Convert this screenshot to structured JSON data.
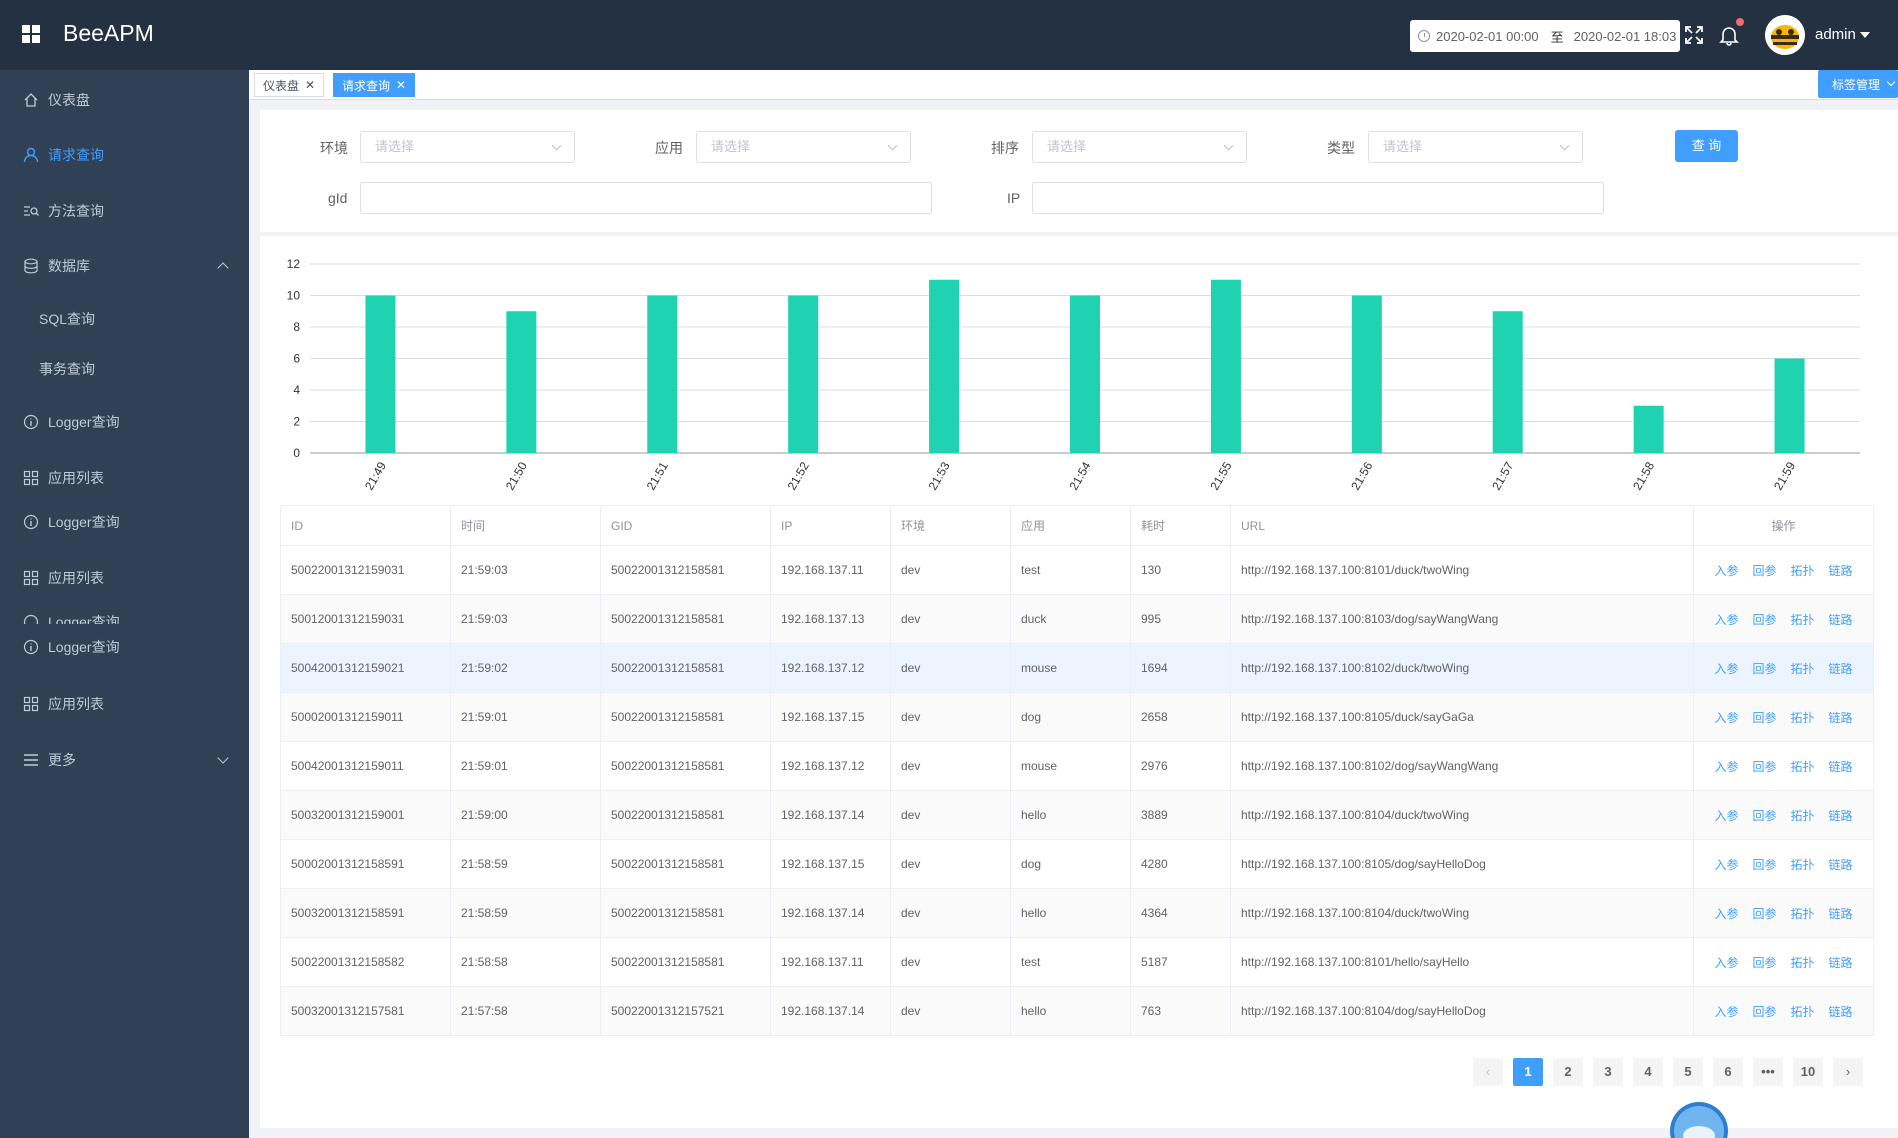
{
  "header": {
    "app_title": "BeeAPM",
    "date_start": "2020-02-01 00:00",
    "date_sep": "至",
    "date_end": "2020-02-01 18:03",
    "user_name": "admin"
  },
  "sidebar": {
    "items": [
      {
        "label": "仪表盘",
        "icon": "home-icon"
      },
      {
        "label": "请求查询",
        "icon": "user-icon"
      },
      {
        "label": "方法查询",
        "icon": "list-search-icon"
      },
      {
        "label": "数据库",
        "icon": "database-icon"
      },
      {
        "label": "SQL查询"
      },
      {
        "label": "事务查询"
      },
      {
        "label": "Logger查询",
        "icon": "info-icon"
      },
      {
        "label": "应用列表",
        "icon": "grid-icon"
      },
      {
        "label": "Logger查询",
        "icon": "info-icon"
      },
      {
        "label": "应用列表",
        "icon": "grid-icon"
      },
      {
        "label": "Logger查询",
        "icon": "info-icon"
      },
      {
        "label": "Logger查询",
        "icon": "info-icon"
      },
      {
        "label": "应用列表",
        "icon": "grid-icon"
      },
      {
        "label": "更多",
        "icon": "menu-icon"
      }
    ]
  },
  "tags": {
    "items": [
      "仪表盘",
      "请求查询"
    ],
    "manage": "标签管理"
  },
  "filters": {
    "env_label": "环境",
    "app_label": "应用",
    "sort_label": "排序",
    "type_label": "类型",
    "select_placeholder": "请选择",
    "gid_label": "gId",
    "ip_label": "IP",
    "search_button": "查 询"
  },
  "chart_data": {
    "type": "bar",
    "categories": [
      "21:49",
      "21:50",
      "21:51",
      "21:52",
      "21:53",
      "21:54",
      "21:55",
      "21:56",
      "21:57",
      "21:58",
      "21:59"
    ],
    "values": [
      10,
      9,
      10,
      10,
      11,
      10,
      11,
      10,
      9,
      3,
      6
    ],
    "ylim": [
      0,
      12
    ],
    "yticks": [
      0,
      2,
      4,
      6,
      8,
      10,
      12
    ],
    "color": "#1fd3b0",
    "grid": true
  },
  "table": {
    "headers": [
      "ID",
      "时间",
      "GID",
      "IP",
      "环境",
      "应用",
      "耗时",
      "URL",
      "操作"
    ],
    "ops": [
      "入参",
      "回参",
      "拓扑",
      "链路"
    ],
    "rows": [
      [
        "50022001312159031",
        "21:59:03",
        "50022001312158581",
        "192.168.137.11",
        "dev",
        "test",
        "130",
        "http://192.168.137.100:8101/duck/twoWing"
      ],
      [
        "50012001312159031",
        "21:59:03",
        "50022001312158581",
        "192.168.137.13",
        "dev",
        "duck",
        "995",
        "http://192.168.137.100:8103/dog/sayWangWang"
      ],
      [
        "50042001312159021",
        "21:59:02",
        "50022001312158581",
        "192.168.137.12",
        "dev",
        "mouse",
        "1694",
        "http://192.168.137.100:8102/duck/twoWing"
      ],
      [
        "50002001312159011",
        "21:59:01",
        "50022001312158581",
        "192.168.137.15",
        "dev",
        "dog",
        "2658",
        "http://192.168.137.100:8105/duck/sayGaGa"
      ],
      [
        "50042001312159011",
        "21:59:01",
        "50022001312158581",
        "192.168.137.12",
        "dev",
        "mouse",
        "2976",
        "http://192.168.137.100:8102/dog/sayWangWang"
      ],
      [
        "50032001312159001",
        "21:59:00",
        "50022001312158581",
        "192.168.137.14",
        "dev",
        "hello",
        "3889",
        "http://192.168.137.100:8104/duck/twoWing"
      ],
      [
        "50002001312158591",
        "21:58:59",
        "50022001312158581",
        "192.168.137.15",
        "dev",
        "dog",
        "4280",
        "http://192.168.137.100:8105/dog/sayHelloDog"
      ],
      [
        "50032001312158591",
        "21:58:59",
        "50022001312158581",
        "192.168.137.14",
        "dev",
        "hello",
        "4364",
        "http://192.168.137.100:8104/duck/twoWing"
      ],
      [
        "50022001312158582",
        "21:58:58",
        "50022001312158581",
        "192.168.137.11",
        "dev",
        "test",
        "5187",
        "http://192.168.137.100:8101/hello/sayHello"
      ],
      [
        "50032001312157581",
        "21:57:58",
        "50022001312157521",
        "192.168.137.14",
        "dev",
        "hello",
        "763",
        "http://192.168.137.100:8104/dog/sayHelloDog"
      ]
    ]
  },
  "pagination": {
    "pages": [
      "1",
      "2",
      "3",
      "4",
      "5",
      "6",
      "•••",
      "10"
    ],
    "current": "1"
  }
}
